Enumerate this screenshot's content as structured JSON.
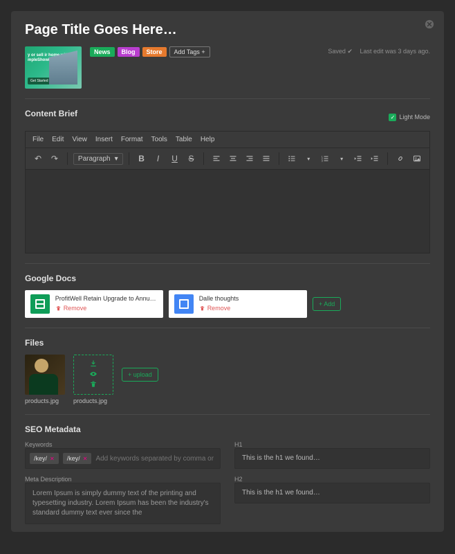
{
  "header": {
    "title": "Page Title Goes Here…",
    "thumb_text": "y or sell\nir home with\nmpleShowing",
    "thumb_cta": "Get Started",
    "tags": [
      {
        "label": "News",
        "cls": "news"
      },
      {
        "label": "Blog",
        "cls": "blog"
      },
      {
        "label": "Store",
        "cls": "store"
      }
    ],
    "add_tags": "Add Tags +",
    "saved": "Saved",
    "last_edit": "Last edit was 3 days ago."
  },
  "brief": {
    "title": "Content Brief",
    "lightmode_label": "Light Mode",
    "menubar": [
      "File",
      "Edit",
      "View",
      "Insert",
      "Format",
      "Tools",
      "Table",
      "Help"
    ],
    "paragraph": "Paragraph"
  },
  "gdocs": {
    "title": "Google Docs",
    "add_label": "+ Add",
    "remove_label": "Remove",
    "items": [
      {
        "kind": "sheets",
        "title": "ProfitWell Retain Upgrade to Annual Tem…"
      },
      {
        "kind": "docs",
        "title": "Dalle thoughts"
      }
    ]
  },
  "files": {
    "title": "Files",
    "upload_label": "+ upload",
    "items": [
      {
        "name": "products.jpg"
      },
      {
        "name": "products.jpg"
      }
    ]
  },
  "seo": {
    "title": "SEO Metadata",
    "kw_label": "Keywords",
    "kw_items": [
      "/key/",
      "/key/"
    ],
    "kw_placeholder": "Add keywords separated by comma or Enter",
    "meta_label": "Meta Description",
    "meta_text": "Lorem Ipsum is simply dummy text of the printing and typesetting industry. Lorem Ipsum has been the industry's standard dummy text ever since the",
    "h1_label": "H1",
    "h1_text": "This is the h1 we found…",
    "h2_label": "H2",
    "h2_text": "This is the h1 we found…"
  }
}
